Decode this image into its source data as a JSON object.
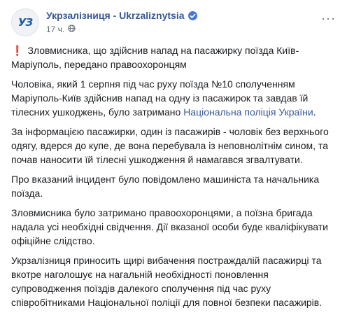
{
  "page": {
    "name": "Укрзалізниця - Ukrzaliznytsia",
    "avatar_text": "УЗ",
    "time": "17 ч.",
    "more_label": "···"
  },
  "post": {
    "headline_icon": "❗",
    "headline": "Зловмисника, що здійснив напад на пасажирку поїзда Київ-Маріуполь, передано правоохоронцям",
    "p1_text": "Чоловіка, який 1 серпня під час руху поїзда №10 сполученням Маріуполь-Київ здійснив напад на одну із пасажирок та завдав їй тілесних ушкоджень, було затримано ",
    "p1_link": "Національна поліція України",
    "p1_end": ".",
    "p2": "За інформацією пасажирки, один із пасажирів - чоловік без верхнього одягу, вдерся до купе, де вона перебувала із неповнолітнім сином, та почав наносити їй тілесні ушкодження й намагався згвалтувати.",
    "p3": "Про вказаний інцидент було повідомлено машиніста та начальника поїзда.",
    "p4": "Зловмисника було затримано правоохоронцями, а поїзна бригада надала усі необхідні свідчення. Дії вказаної особи буде кваліфікувати офіційне слідство.",
    "p5": "Укрзалізниця приносить щирі вибачення постраждалій пасажирці та вкотре наголошує на нагальній необхідності поновлення супроводження поїздів далекого сполучення під час руху співробітниками Національної поліції для повної безпеки пасажирів."
  },
  "icons": {
    "verified": "verified-badge-icon",
    "globe": "globe-icon",
    "more": "more-dots-icon"
  }
}
